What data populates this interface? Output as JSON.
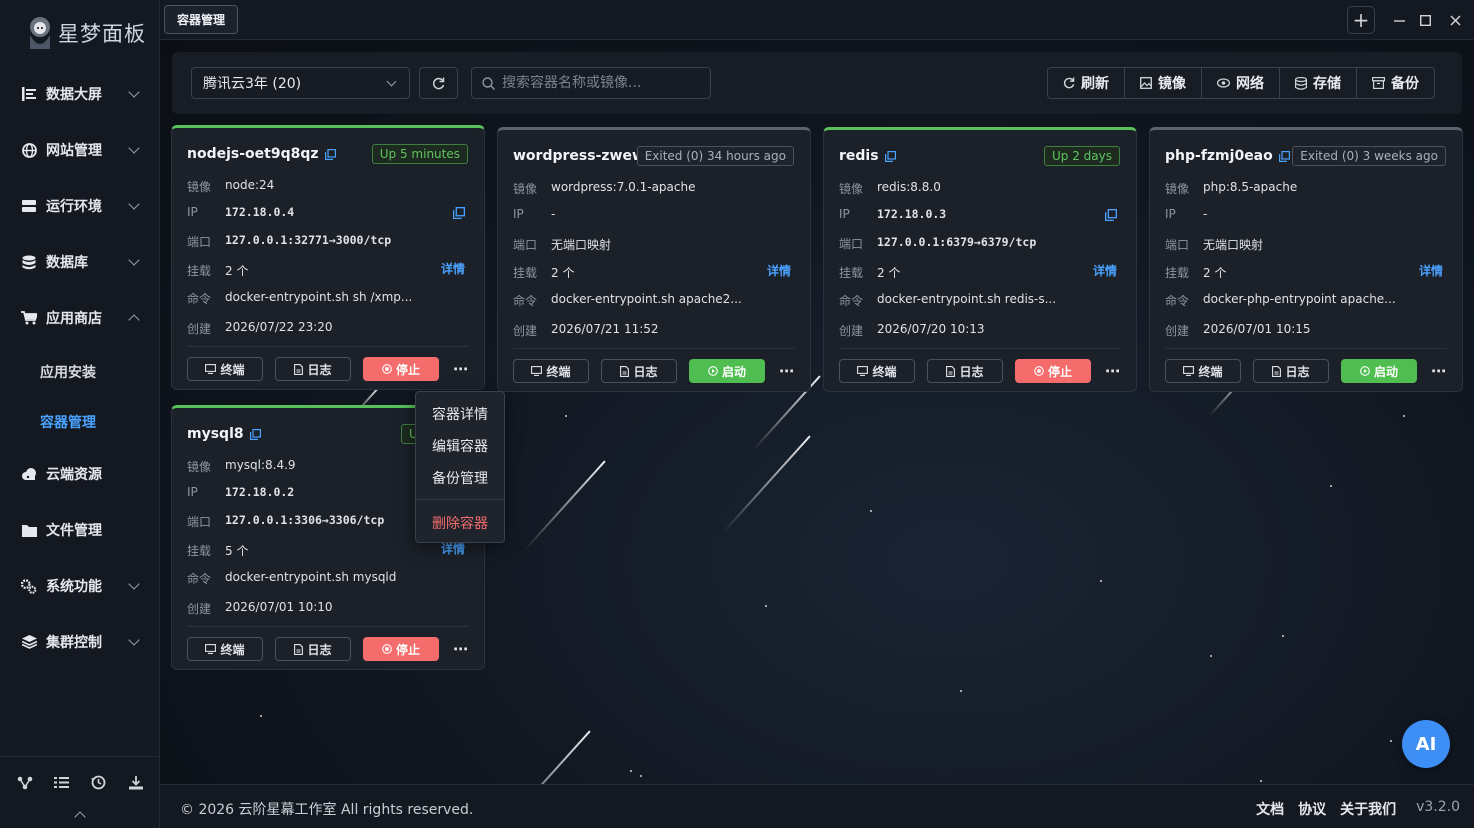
{
  "app": {
    "logo_text": "星梦面板"
  },
  "sidebar": {
    "items": [
      {
        "label": "数据大屏",
        "icon": "dashboard-icon"
      },
      {
        "label": "网站管理",
        "icon": "globe-icon"
      },
      {
        "label": "运行环境",
        "icon": "server-icon"
      },
      {
        "label": "数据库",
        "icon": "database-icon"
      },
      {
        "label": "应用商店",
        "icon": "cart-icon"
      },
      {
        "label": "云端资源",
        "icon": "cloud-icon"
      },
      {
        "label": "文件管理",
        "icon": "folder-icon"
      },
      {
        "label": "系统功能",
        "icon": "gears-icon"
      },
      {
        "label": "集群控制",
        "icon": "layers-icon"
      }
    ],
    "sub_items": [
      {
        "label": "应用安装"
      },
      {
        "label": "容器管理",
        "active": true
      }
    ]
  },
  "topbar": {
    "tab_label": "容器管理",
    "add_label": "+"
  },
  "toolbar": {
    "server_select": "腾讯云3年 (20)",
    "search_placeholder": "搜索容器名称或镜像...",
    "buttons": [
      "刷新",
      "镜像",
      "网络",
      "存储",
      "备份"
    ]
  },
  "labels": {
    "image": "镜像",
    "ip": "IP",
    "port": "端口",
    "mount": "挂载",
    "cmd": "命令",
    "created": "创建",
    "detail": "详情",
    "terminal": "终端",
    "logs": "日志",
    "stop": "停止",
    "start": "启动"
  },
  "containers": [
    {
      "name": "nodejs-oet9q8qz",
      "status": "Up 5 minutes",
      "state": "running",
      "image": "node:24",
      "ip": "172.18.0.4",
      "port": "127.0.0.1:32771→3000/tcp",
      "mounts": "2 个",
      "command": "docker-entrypoint.sh sh /xmp...",
      "created": "2026/07/22 23:20"
    },
    {
      "name": "wordpress-zwew...",
      "status": "Exited (0) 34 hours ago",
      "state": "exited",
      "image": "wordpress:7.0.1-apache",
      "ip": "-",
      "port": "无端口映射",
      "mounts": "2 个",
      "command": "docker-entrypoint.sh apache2...",
      "created": "2026/07/21 11:52"
    },
    {
      "name": "redis",
      "status": "Up 2 days",
      "state": "running",
      "image": "redis:8.8.0",
      "ip": "172.18.0.3",
      "port": "127.0.0.1:6379→6379/tcp",
      "mounts": "2 个",
      "command": "docker-entrypoint.sh redis-s...",
      "created": "2026/07/20 10:13"
    },
    {
      "name": "php-fzmj0eao",
      "status": "Exited (0) 3 weeks ago",
      "state": "exited",
      "image": "php:8.5-apache",
      "ip": "-",
      "port": "无端口映射",
      "mounts": "2 个",
      "command": "docker-php-entrypoint apache...",
      "created": "2026/07/01 10:15"
    },
    {
      "name": "mysql8",
      "status": "U",
      "state": "running",
      "image": "mysql:8.4.9",
      "ip": "172.18.0.2",
      "port": "127.0.0.1:3306→3306/tcp",
      "mounts": "5 个",
      "command": "docker-entrypoint.sh mysqld",
      "created": "2026/07/01 10:10"
    }
  ],
  "context_menu": {
    "items": [
      "容器详情",
      "编辑容器",
      "备份管理"
    ],
    "danger_item": "删除容器"
  },
  "footer": {
    "copyright": "© 2026 云阶星幕工作室 All rights reserved.",
    "links": [
      "文档",
      "协议",
      "关于我们"
    ],
    "version": "v3.2.0"
  },
  "ai_button": "AI",
  "colors": {
    "accent": "#4aa3ff",
    "running": "#58c15b",
    "stop": "#f56c6c",
    "start": "#4fbd4f"
  }
}
